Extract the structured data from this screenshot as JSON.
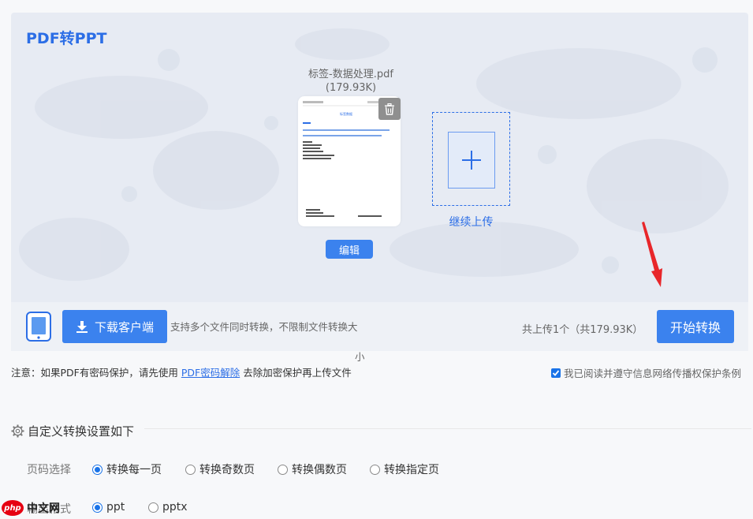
{
  "app": {
    "title": "PDF转PPT"
  },
  "file": {
    "name": "标签-数据处理.pdf",
    "size": "(179.93K)",
    "preview_heading": "标签数据",
    "edit_label": "编辑"
  },
  "upload": {
    "label": "继续上传"
  },
  "toolbar": {
    "download_label": "下载客户端",
    "multi_tip": "支持多个文件同时转换，不限制文件转换大",
    "multi_tip_tail": "小",
    "count": "共上传1个（共179.93K）",
    "start_label": "开始转换"
  },
  "notice": {
    "prefix": "注意：如果PDF有密码保护，请先使用",
    "link": "PDF密码解除",
    "suffix": "去除加密保护再上传文件"
  },
  "agreement": {
    "label": "我已阅读并遵守信息网络传播权保护条例",
    "checked": true
  },
  "settings": {
    "title": "自定义转换设置如下",
    "page_label": "页码选择",
    "page_options": [
      "转换每一页",
      "转换奇数页",
      "转换偶数页",
      "转换指定页"
    ],
    "page_selected": 0,
    "format_label": "输出格式",
    "format_options": [
      "ppt",
      "pptx"
    ],
    "format_selected": 0
  },
  "watermark": {
    "logo": "php",
    "text": "中文网"
  },
  "colors": {
    "accent": "#3b82ee",
    "link": "#2c6ee6",
    "arrow": "#e8262a"
  }
}
